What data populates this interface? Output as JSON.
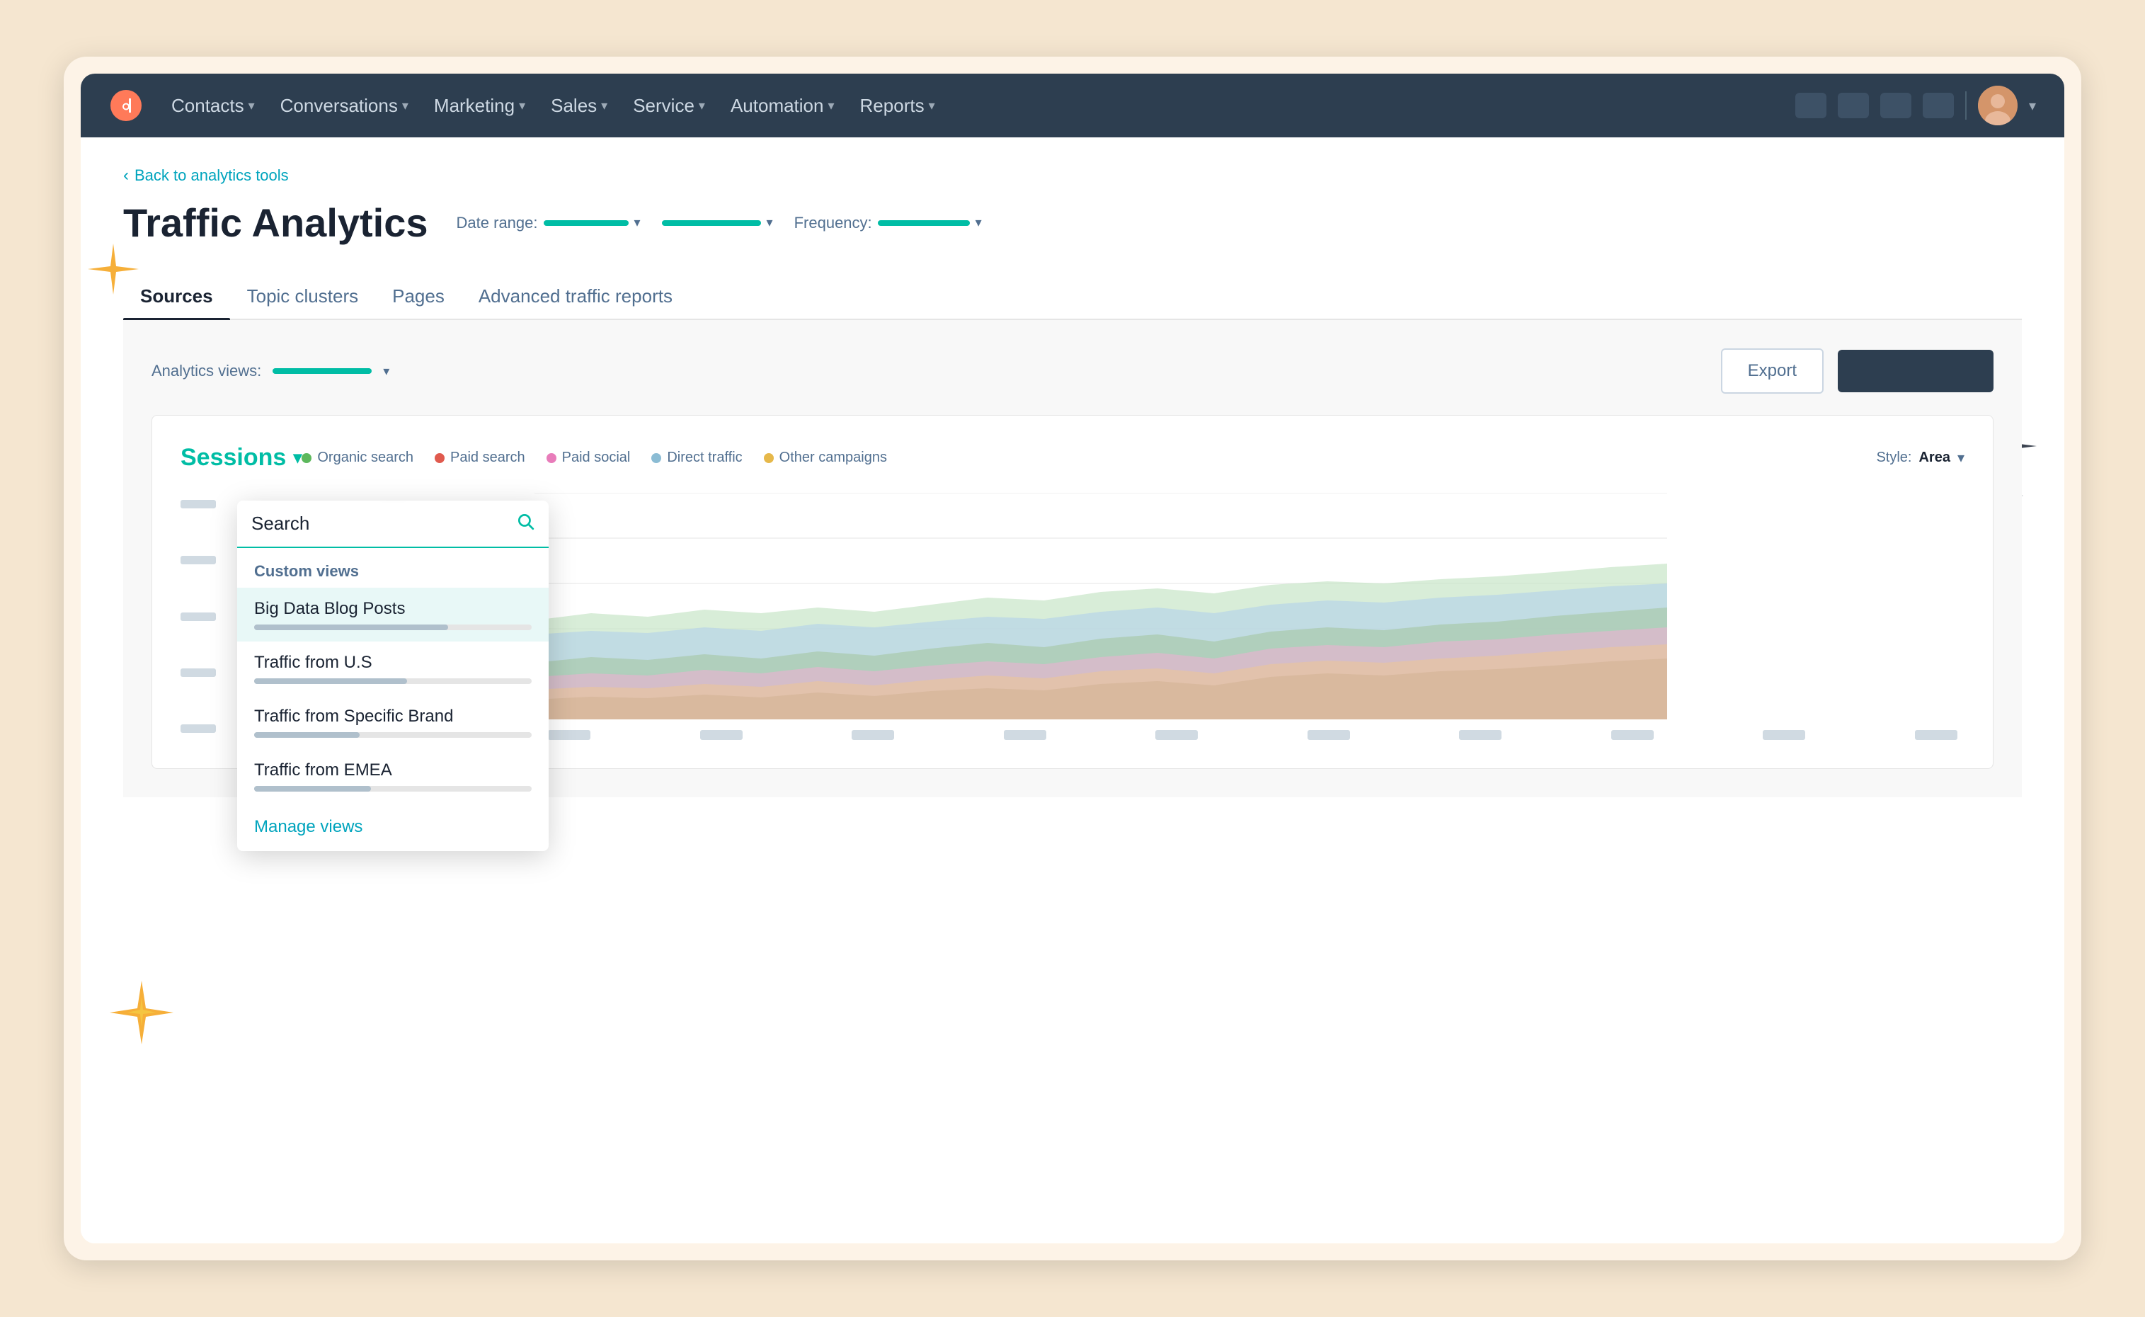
{
  "outer": {
    "background_color": "#fdf3e7"
  },
  "topnav": {
    "logo_alt": "HubSpot Logo",
    "nav_items": [
      {
        "label": "Contacts",
        "has_dropdown": true
      },
      {
        "label": "Conversations",
        "has_dropdown": true
      },
      {
        "label": "Marketing",
        "has_dropdown": true
      },
      {
        "label": "Sales",
        "has_dropdown": true
      },
      {
        "label": "Service",
        "has_dropdown": true
      },
      {
        "label": "Automation",
        "has_dropdown": true
      },
      {
        "label": "Reports",
        "has_dropdown": true
      }
    ]
  },
  "page": {
    "back_link": "Back to analytics tools",
    "title": "Traffic Analytics",
    "date_range_label": "Date range:",
    "frequency_label": "Frequency:"
  },
  "tabs": [
    {
      "label": "Sources",
      "active": true
    },
    {
      "label": "Topic clusters",
      "active": false
    },
    {
      "label": "Pages",
      "active": false
    },
    {
      "label": "Advanced traffic reports",
      "active": false
    }
  ],
  "analytics": {
    "views_label": "Analytics views:",
    "export_button": "Export",
    "primary_button": ""
  },
  "chart": {
    "sessions_label": "Sessions",
    "style_label": "Style:",
    "style_value": "Area",
    "legend": [
      {
        "label": "Organic search",
        "color": "#5cb85c"
      },
      {
        "label": "Paid search",
        "color": "#e05a4e"
      },
      {
        "label": "Paid social",
        "color": "#e87cba"
      },
      {
        "label": "Direct traffic",
        "color": "#8bbcd4"
      },
      {
        "label": "Other campaigns",
        "color": "#e6b84a"
      }
    ]
  },
  "dropdown": {
    "search_placeholder": "Search",
    "section_label": "Custom views",
    "items": [
      {
        "name": "Big Data Blog Posts",
        "bar_width": "70%",
        "selected": true
      },
      {
        "name": "Traffic from U.S",
        "bar_width": "55%",
        "selected": false
      },
      {
        "name": "Traffic from Specific Brand",
        "bar_width": "38%",
        "selected": false
      },
      {
        "name": "Traffic from EMEA",
        "bar_width": "42%",
        "selected": false
      }
    ],
    "manage_link": "Manage views"
  }
}
